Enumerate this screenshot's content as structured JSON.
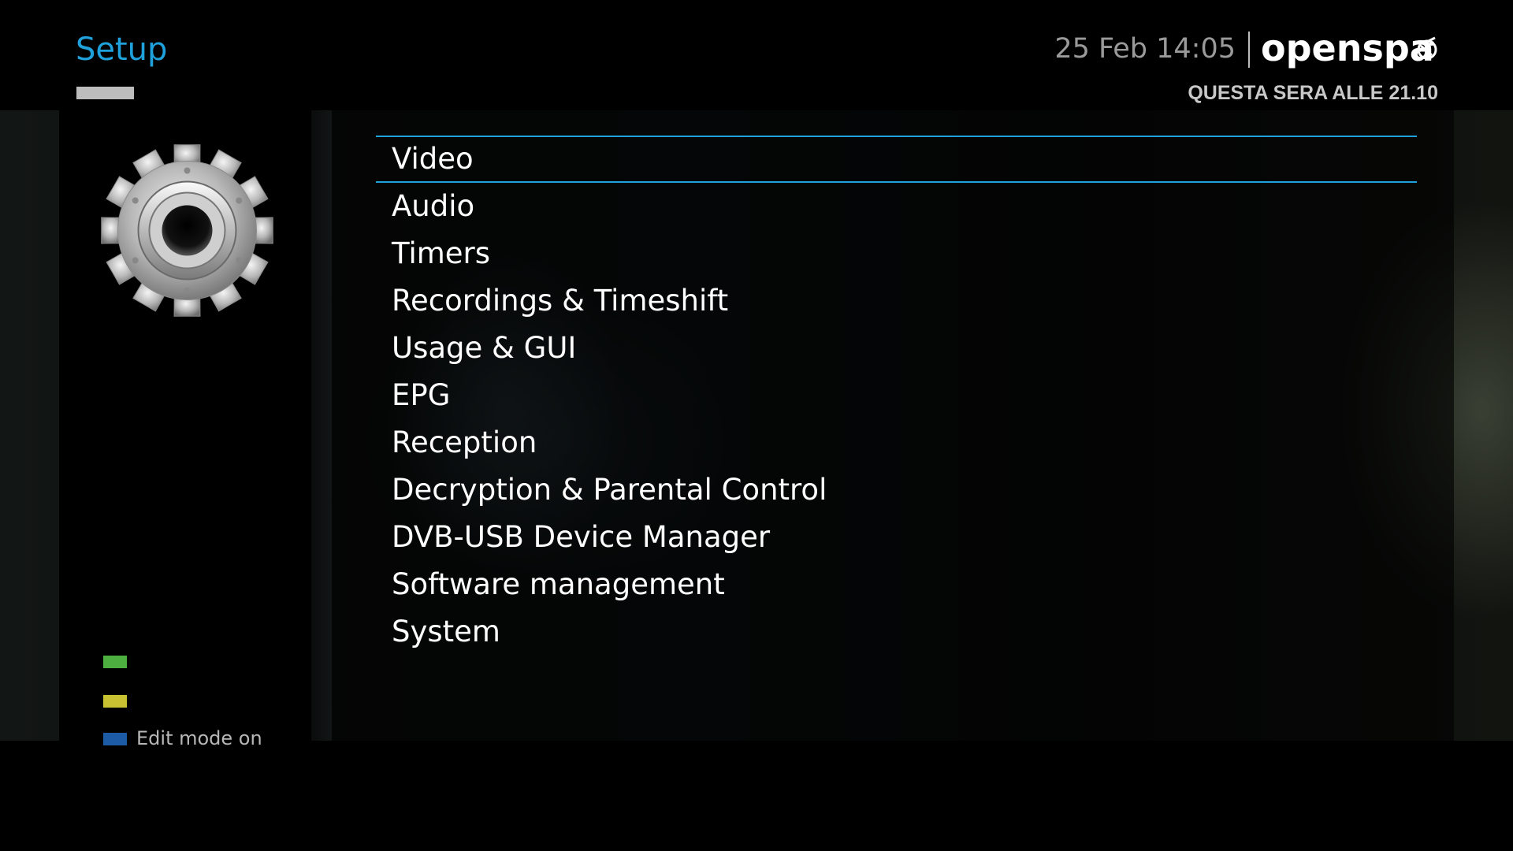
{
  "header": {
    "title": "Setup",
    "clock": "25 Feb 14:05",
    "brand": "openspa",
    "now_playing": "QUESTA SERA ALLE 21.10"
  },
  "sidebar": {
    "icon": "gear-icon",
    "legend": [
      {
        "color": "#4caf3f",
        "label": ""
      },
      {
        "color": "#c8c232",
        "label": ""
      },
      {
        "color": "#1e5ba6",
        "label": "Edit mode on"
      }
    ]
  },
  "menu": {
    "selected_index": 0,
    "items": [
      {
        "label": "Video"
      },
      {
        "label": "Audio"
      },
      {
        "label": "Timers"
      },
      {
        "label": "Recordings & Timeshift"
      },
      {
        "label": "Usage & GUI"
      },
      {
        "label": "EPG"
      },
      {
        "label": "Reception"
      },
      {
        "label": "Decryption & Parental Control"
      },
      {
        "label": "DVB-USB Device Manager"
      },
      {
        "label": "Software management"
      },
      {
        "label": "System"
      }
    ]
  },
  "colors": {
    "accent": "#1fa1dc",
    "text": "#ffffff",
    "muted": "#9a9a9a"
  }
}
